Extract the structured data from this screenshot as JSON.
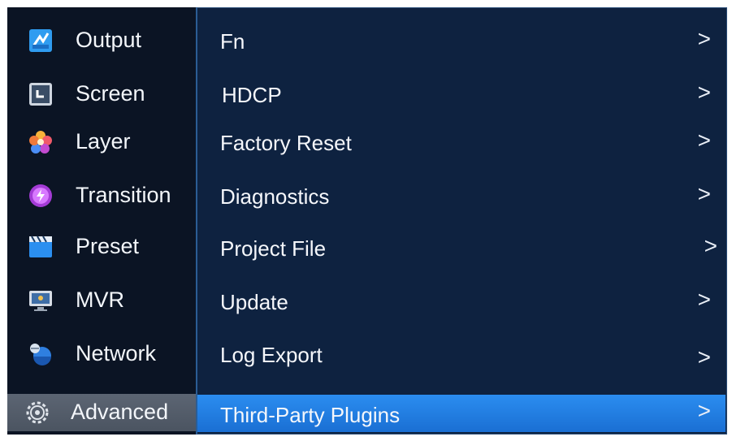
{
  "sidebar": {
    "items": [
      {
        "label": "Output",
        "icon": "output-icon"
      },
      {
        "label": "Screen",
        "icon": "screen-icon"
      },
      {
        "label": "Layer",
        "icon": "layer-icon"
      },
      {
        "label": "Transition",
        "icon": "transition-icon"
      },
      {
        "label": "Preset",
        "icon": "preset-icon"
      },
      {
        "label": "MVR",
        "icon": "mvr-icon"
      },
      {
        "label": "Network",
        "icon": "network-icon"
      },
      {
        "label": "Advanced",
        "icon": "gear-icon"
      }
    ]
  },
  "submenu": {
    "items": [
      {
        "label": "Fn",
        "chevron": ">"
      },
      {
        "label": "HDCP",
        "chevron": ">"
      },
      {
        "label": "Factory Reset",
        "chevron": ">"
      },
      {
        "label": "Diagnostics",
        "chevron": ">"
      },
      {
        "label": "Project File",
        "chevron": ">"
      },
      {
        "label": "Update",
        "chevron": ">"
      },
      {
        "label": "Log Export",
        "chevron": ">"
      },
      {
        "label": "Third-Party Plugins",
        "chevron": ">"
      }
    ]
  },
  "colors": {
    "background": "#0b1424",
    "panel": "#0e2240",
    "selection": "#2b8df0",
    "sidebar_active": "#5c6573"
  }
}
